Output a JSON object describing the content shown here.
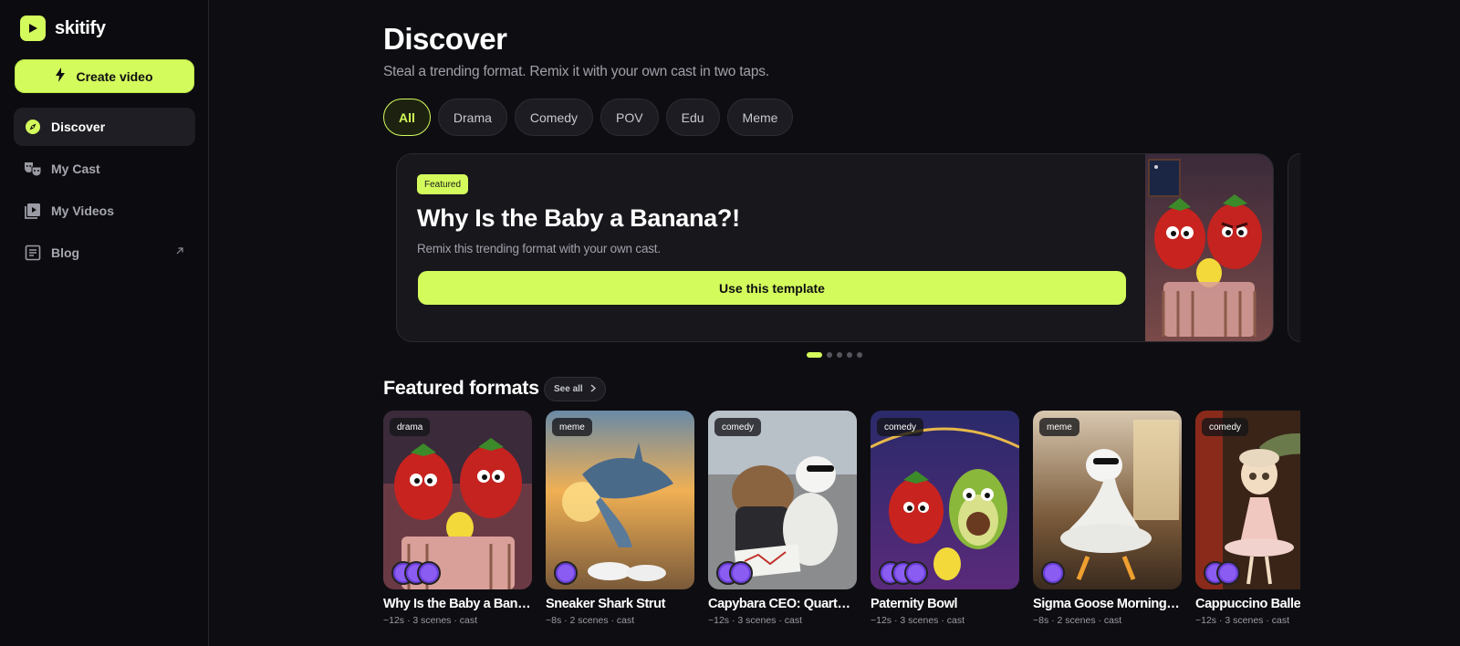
{
  "brand": {
    "name": "skitify",
    "accent": "#d4fb5c"
  },
  "sidebar": {
    "create_label": "Create video",
    "items": [
      {
        "label": "Discover",
        "icon": "compass-icon",
        "active": true
      },
      {
        "label": "My Cast",
        "icon": "theater-masks-icon",
        "active": false
      },
      {
        "label": "My Videos",
        "icon": "video-library-icon",
        "active": false
      },
      {
        "label": "Blog",
        "icon": "article-icon",
        "active": false,
        "external": true
      }
    ]
  },
  "header": {
    "title": "Discover",
    "subtitle": "Steal a trending format. Remix it with your own cast in two taps."
  },
  "filters": [
    {
      "label": "All",
      "active": true
    },
    {
      "label": "Drama",
      "active": false
    },
    {
      "label": "Comedy",
      "active": false
    },
    {
      "label": "POV",
      "active": false
    },
    {
      "label": "Edu",
      "active": false
    },
    {
      "label": "Meme",
      "active": false
    }
  ],
  "hero": {
    "badge": "Featured",
    "title": "Why Is the Baby a Banana?!",
    "subtitle": "Remix this trending format with your own cast.",
    "cta": "Use this template",
    "slide_count": 5,
    "active_slide": 1
  },
  "featured": {
    "title": "Featured formats",
    "see_all": "See all",
    "cards": [
      {
        "tag": "drama",
        "title": "Why Is the Baby a Banana?!",
        "meta": "~12s · 3 scenes · cast",
        "avatars": 3
      },
      {
        "tag": "meme",
        "title": "Sneaker Shark Strut",
        "meta": "~8s · 2 scenes · cast",
        "avatars": 1
      },
      {
        "tag": "comedy",
        "title": "Capybara CEO: Quarterly Panic",
        "meta": "~12s · 3 scenes · cast",
        "avatars": 2
      },
      {
        "tag": "comedy",
        "title": "Paternity Bowl",
        "meta": "~12s · 3 scenes · cast",
        "avatars": 3
      },
      {
        "tag": "meme",
        "title": "Sigma Goose Morning Routine",
        "meta": "~8s · 2 scenes · cast",
        "avatars": 1
      },
      {
        "tag": "comedy",
        "title": "Cappuccino Ballerina",
        "meta": "~12s · 3 scenes · cast",
        "avatars": 2
      }
    ]
  }
}
